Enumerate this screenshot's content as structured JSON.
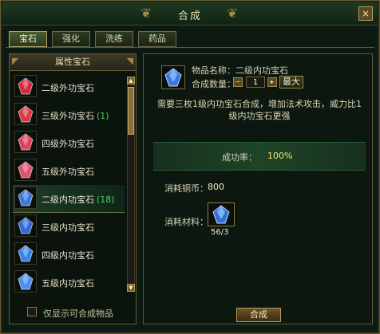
{
  "window": {
    "title": "合成",
    "close_glyph": "×"
  },
  "tabs": [
    {
      "label": "宝石",
      "active": true
    },
    {
      "label": "强化",
      "active": false
    },
    {
      "label": "洗练",
      "active": false
    },
    {
      "label": "药品",
      "active": false
    }
  ],
  "left_panel": {
    "header": "属性宝石",
    "items": [
      {
        "name": "二级外功宝石",
        "count": "",
        "gem_color": "#d4283c",
        "selected": false
      },
      {
        "name": "三级外功宝石",
        "count": "(1)",
        "gem_color": "#d83848",
        "selected": false
      },
      {
        "name": "四级外功宝石",
        "count": "",
        "gem_color": "#e04058",
        "selected": false
      },
      {
        "name": "五级外功宝石",
        "count": "",
        "gem_color": "#e05070",
        "selected": false
      },
      {
        "name": "二级内功宝石",
        "count": "(18)",
        "gem_color": "#3a78e0",
        "selected": true
      },
      {
        "name": "三级内功宝石",
        "count": "",
        "gem_color": "#2f6ad8",
        "selected": false
      },
      {
        "name": "四级内功宝石",
        "count": "",
        "gem_color": "#3a84ea",
        "selected": false
      },
      {
        "name": "五级内功宝石",
        "count": "",
        "gem_color": "#4a90f0",
        "selected": false
      }
    ],
    "checkbox_label": "仅显示可合成物品",
    "checkbox_checked": false
  },
  "right_panel": {
    "product_label": "物品名称：二级内功宝石",
    "quantity_label": "合成数量：",
    "quantity_value": "1",
    "max_label": "最大",
    "description": "需要三枚1级内功宝石合成，增加法术攻击，威力比1级内功宝石更强",
    "rate_label": "成功率：",
    "rate_value": "100%",
    "cost_label": "消耗铜币：",
    "cost_value": "800",
    "material_label": "消耗材料：",
    "material_count": "56/3",
    "craft_label": "合成"
  },
  "icons": {
    "close": "close-icon",
    "scroll_up": "arrow-up-icon",
    "scroll_down": "arrow-down-icon",
    "minus": "minus-icon",
    "plus": "plus-icon",
    "gem": "gem-icon"
  }
}
